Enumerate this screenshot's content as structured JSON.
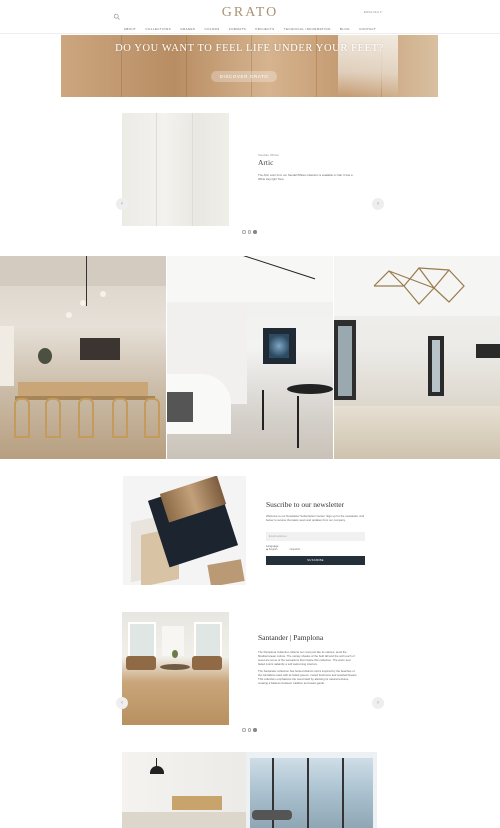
{
  "header": {
    "logo": "GRATO",
    "language": "ENGLISH",
    "nav": [
      "ABOUT",
      "COLLECTIONS",
      "GRADES",
      "COLORS",
      "FORMATS",
      "PROJECTS",
      "TECHNICAL INFORMATION",
      "BLOG",
      "CONTACT"
    ]
  },
  "hero": {
    "headline": "DO YOU WANT TO FEEL LIFE UNDER YOUR FEET?",
    "cta_label": "DISCOVER GRATO"
  },
  "product": {
    "series": "Sandalo Whites",
    "name": "Artic",
    "description": "The Artic color from our Sandal Whites collection is available in Oak. It has a White Hey light Tone.",
    "carousel_active_index": 2
  },
  "newsletter": {
    "title": "Suscribe to our newsletter",
    "description": "Welcome to our Newsletter Subscription Center. Sign up for the newsletter. And below to receive the latest news and updates from our company.",
    "email_placeholder": "Email address",
    "language_label": "Language",
    "options": [
      "English",
      "Español"
    ],
    "button_label": "SUSCRIBE"
  },
  "collection": {
    "title": "Santander | Pamplona",
    "paragraphs": [
      "The Pamplona Collection reflects our roots just like its nations, amid the Mediterranean culture. The variety shades of the built fall and the soft touch of wood are some of the sensations that inspire this collection. The warm and faded colors radiantly a soft welcoming interiors.",
      "The Santander collection has hosted distinct colors inspired by the beaches of the Cantabria coast with its faded greens, muted freshness and seashell linears. This collection emphasizes the wood itself by allowing its natural textures, creating a balance between tradition and avant-garde."
    ],
    "carousel_active_index": 2
  },
  "icons": {
    "search": "search-icon",
    "prev": "chevron-left-icon",
    "next": "chevron-right-icon"
  }
}
